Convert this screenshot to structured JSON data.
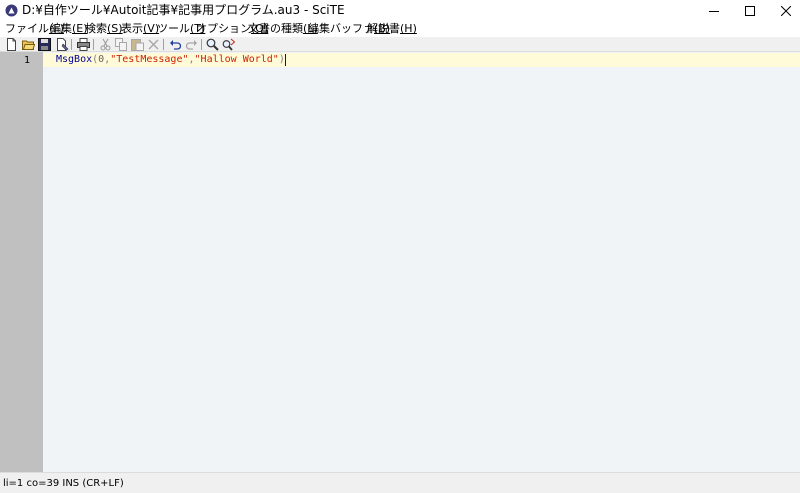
{
  "window": {
    "title": "D:¥自作ツール¥Autoit記事¥記事用プログラム.au3 - SciTE"
  },
  "menu": [
    {
      "label": "ファイル",
      "key": "(F)"
    },
    {
      "label": "編集",
      "key": "(E)"
    },
    {
      "label": "検索",
      "key": "(S)"
    },
    {
      "label": "表示",
      "key": "(V)"
    },
    {
      "label": "ツール",
      "key": "(T)"
    },
    {
      "label": "オプション",
      "key": "(O)"
    },
    {
      "label": "文書の種類",
      "key": "(L)"
    },
    {
      "label": "編集バッファ",
      "key": "(B)"
    },
    {
      "label": "解説書",
      "key": "(H)"
    }
  ],
  "toolbar": {
    "icons": [
      "new-file-icon",
      "open-folder-icon",
      "save-icon",
      "save-as-icon",
      "print-icon",
      "cut-icon",
      "copy-icon",
      "paste-icon",
      "delete-icon",
      "undo-icon",
      "redo-icon",
      "find-icon",
      "replace-icon"
    ]
  },
  "editor": {
    "line_number": "1",
    "code": {
      "func": "MsgBox",
      "open": "(",
      "num": "0",
      "comma1": ",",
      "str1": "\"TestMessage\"",
      "comma2": ",",
      "str2": "\"Hallow World\"",
      "close": ")"
    }
  },
  "status": {
    "text": "li=1 co=39 INS (CR+LF)"
  },
  "colors": {
    "caret_line": "#fffbd9",
    "editor_bg": "#f0f4f7",
    "gutter_bg": "#c0c0c0",
    "string": "#cc2200",
    "function": "#000090"
  }
}
